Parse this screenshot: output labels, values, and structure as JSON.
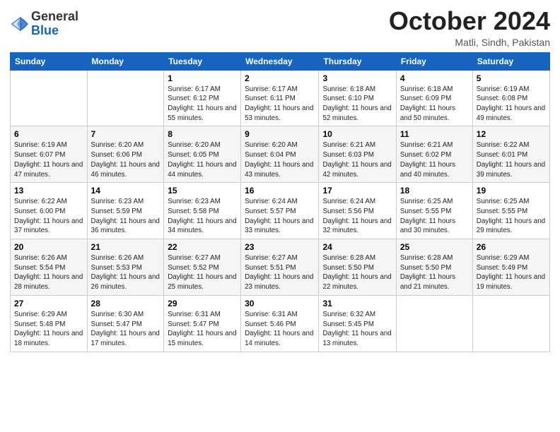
{
  "header": {
    "logo": {
      "line1": "General",
      "line2": "Blue"
    },
    "month": "October 2024",
    "location": "Matli, Sindh, Pakistan"
  },
  "weekdays": [
    "Sunday",
    "Monday",
    "Tuesday",
    "Wednesday",
    "Thursday",
    "Friday",
    "Saturday"
  ],
  "weeks": [
    [
      {
        "day": "",
        "sunrise": "",
        "sunset": "",
        "daylight": ""
      },
      {
        "day": "",
        "sunrise": "",
        "sunset": "",
        "daylight": ""
      },
      {
        "day": "1",
        "sunrise": "Sunrise: 6:17 AM",
        "sunset": "Sunset: 6:12 PM",
        "daylight": "Daylight: 11 hours and 55 minutes."
      },
      {
        "day": "2",
        "sunrise": "Sunrise: 6:17 AM",
        "sunset": "Sunset: 6:11 PM",
        "daylight": "Daylight: 11 hours and 53 minutes."
      },
      {
        "day": "3",
        "sunrise": "Sunrise: 6:18 AM",
        "sunset": "Sunset: 6:10 PM",
        "daylight": "Daylight: 11 hours and 52 minutes."
      },
      {
        "day": "4",
        "sunrise": "Sunrise: 6:18 AM",
        "sunset": "Sunset: 6:09 PM",
        "daylight": "Daylight: 11 hours and 50 minutes."
      },
      {
        "day": "5",
        "sunrise": "Sunrise: 6:19 AM",
        "sunset": "Sunset: 6:08 PM",
        "daylight": "Daylight: 11 hours and 49 minutes."
      }
    ],
    [
      {
        "day": "6",
        "sunrise": "Sunrise: 6:19 AM",
        "sunset": "Sunset: 6:07 PM",
        "daylight": "Daylight: 11 hours and 47 minutes."
      },
      {
        "day": "7",
        "sunrise": "Sunrise: 6:20 AM",
        "sunset": "Sunset: 6:06 PM",
        "daylight": "Daylight: 11 hours and 46 minutes."
      },
      {
        "day": "8",
        "sunrise": "Sunrise: 6:20 AM",
        "sunset": "Sunset: 6:05 PM",
        "daylight": "Daylight: 11 hours and 44 minutes."
      },
      {
        "day": "9",
        "sunrise": "Sunrise: 6:20 AM",
        "sunset": "Sunset: 6:04 PM",
        "daylight": "Daylight: 11 hours and 43 minutes."
      },
      {
        "day": "10",
        "sunrise": "Sunrise: 6:21 AM",
        "sunset": "Sunset: 6:03 PM",
        "daylight": "Daylight: 11 hours and 42 minutes."
      },
      {
        "day": "11",
        "sunrise": "Sunrise: 6:21 AM",
        "sunset": "Sunset: 6:02 PM",
        "daylight": "Daylight: 11 hours and 40 minutes."
      },
      {
        "day": "12",
        "sunrise": "Sunrise: 6:22 AM",
        "sunset": "Sunset: 6:01 PM",
        "daylight": "Daylight: 11 hours and 39 minutes."
      }
    ],
    [
      {
        "day": "13",
        "sunrise": "Sunrise: 6:22 AM",
        "sunset": "Sunset: 6:00 PM",
        "daylight": "Daylight: 11 hours and 37 minutes."
      },
      {
        "day": "14",
        "sunrise": "Sunrise: 6:23 AM",
        "sunset": "Sunset: 5:59 PM",
        "daylight": "Daylight: 11 hours and 36 minutes."
      },
      {
        "day": "15",
        "sunrise": "Sunrise: 6:23 AM",
        "sunset": "Sunset: 5:58 PM",
        "daylight": "Daylight: 11 hours and 34 minutes."
      },
      {
        "day": "16",
        "sunrise": "Sunrise: 6:24 AM",
        "sunset": "Sunset: 5:57 PM",
        "daylight": "Daylight: 11 hours and 33 minutes."
      },
      {
        "day": "17",
        "sunrise": "Sunrise: 6:24 AM",
        "sunset": "Sunset: 5:56 PM",
        "daylight": "Daylight: 11 hours and 32 minutes."
      },
      {
        "day": "18",
        "sunrise": "Sunrise: 6:25 AM",
        "sunset": "Sunset: 5:55 PM",
        "daylight": "Daylight: 11 hours and 30 minutes."
      },
      {
        "day": "19",
        "sunrise": "Sunrise: 6:25 AM",
        "sunset": "Sunset: 5:55 PM",
        "daylight": "Daylight: 11 hours and 29 minutes."
      }
    ],
    [
      {
        "day": "20",
        "sunrise": "Sunrise: 6:26 AM",
        "sunset": "Sunset: 5:54 PM",
        "daylight": "Daylight: 11 hours and 28 minutes."
      },
      {
        "day": "21",
        "sunrise": "Sunrise: 6:26 AM",
        "sunset": "Sunset: 5:53 PM",
        "daylight": "Daylight: 11 hours and 26 minutes."
      },
      {
        "day": "22",
        "sunrise": "Sunrise: 6:27 AM",
        "sunset": "Sunset: 5:52 PM",
        "daylight": "Daylight: 11 hours and 25 minutes."
      },
      {
        "day": "23",
        "sunrise": "Sunrise: 6:27 AM",
        "sunset": "Sunset: 5:51 PM",
        "daylight": "Daylight: 11 hours and 23 minutes."
      },
      {
        "day": "24",
        "sunrise": "Sunrise: 6:28 AM",
        "sunset": "Sunset: 5:50 PM",
        "daylight": "Daylight: 11 hours and 22 minutes."
      },
      {
        "day": "25",
        "sunrise": "Sunrise: 6:28 AM",
        "sunset": "Sunset: 5:50 PM",
        "daylight": "Daylight: 11 hours and 21 minutes."
      },
      {
        "day": "26",
        "sunrise": "Sunrise: 6:29 AM",
        "sunset": "Sunset: 5:49 PM",
        "daylight": "Daylight: 11 hours and 19 minutes."
      }
    ],
    [
      {
        "day": "27",
        "sunrise": "Sunrise: 6:29 AM",
        "sunset": "Sunset: 5:48 PM",
        "daylight": "Daylight: 11 hours and 18 minutes."
      },
      {
        "day": "28",
        "sunrise": "Sunrise: 6:30 AM",
        "sunset": "Sunset: 5:47 PM",
        "daylight": "Daylight: 11 hours and 17 minutes."
      },
      {
        "day": "29",
        "sunrise": "Sunrise: 6:31 AM",
        "sunset": "Sunset: 5:47 PM",
        "daylight": "Daylight: 11 hours and 15 minutes."
      },
      {
        "day": "30",
        "sunrise": "Sunrise: 6:31 AM",
        "sunset": "Sunset: 5:46 PM",
        "daylight": "Daylight: 11 hours and 14 minutes."
      },
      {
        "day": "31",
        "sunrise": "Sunrise: 6:32 AM",
        "sunset": "Sunset: 5:45 PM",
        "daylight": "Daylight: 11 hours and 13 minutes."
      },
      {
        "day": "",
        "sunrise": "",
        "sunset": "",
        "daylight": ""
      },
      {
        "day": "",
        "sunrise": "",
        "sunset": "",
        "daylight": ""
      }
    ]
  ]
}
